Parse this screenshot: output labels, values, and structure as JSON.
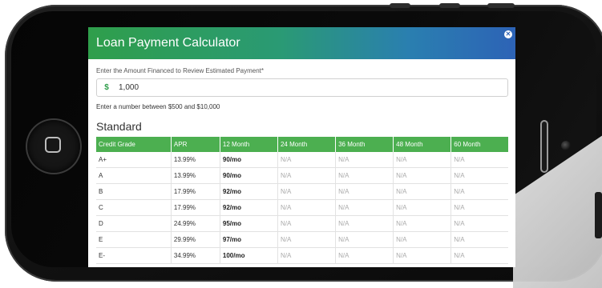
{
  "modal": {
    "title": "Loan Payment Calculator",
    "close_icon": "close-icon",
    "amount_label": "Enter the Amount Financed to Review Estimated Payment*",
    "currency_symbol": "$",
    "amount_value": "1,000",
    "hint": "Enter a number between $500 and $10,000",
    "section_title": "Standard",
    "table": {
      "headers": [
        "Credit Grade",
        "APR",
        "12 Month",
        "24 Month",
        "36 Month",
        "48 Month",
        "60 Month"
      ],
      "rows": [
        [
          "A+",
          "13.99%",
          "90/mo",
          "N/A",
          "N/A",
          "N/A",
          "N/A"
        ],
        [
          "A",
          "13.99%",
          "90/mo",
          "N/A",
          "N/A",
          "N/A",
          "N/A"
        ],
        [
          "B",
          "17.99%",
          "92/mo",
          "N/A",
          "N/A",
          "N/A",
          "N/A"
        ],
        [
          "C",
          "17.99%",
          "92/mo",
          "N/A",
          "N/A",
          "N/A",
          "N/A"
        ],
        [
          "D",
          "24.99%",
          "95/mo",
          "N/A",
          "N/A",
          "N/A",
          "N/A"
        ],
        [
          "E",
          "29.99%",
          "97/mo",
          "N/A",
          "N/A",
          "N/A",
          "N/A"
        ],
        [
          "E-",
          "34.99%",
          "100/mo",
          "N/A",
          "N/A",
          "N/A",
          "N/A"
        ]
      ]
    }
  },
  "colors": {
    "header_green": "#4caf50",
    "header_gradient_start": "#2f9e4b",
    "header_gradient_end": "#2d63b6"
  }
}
